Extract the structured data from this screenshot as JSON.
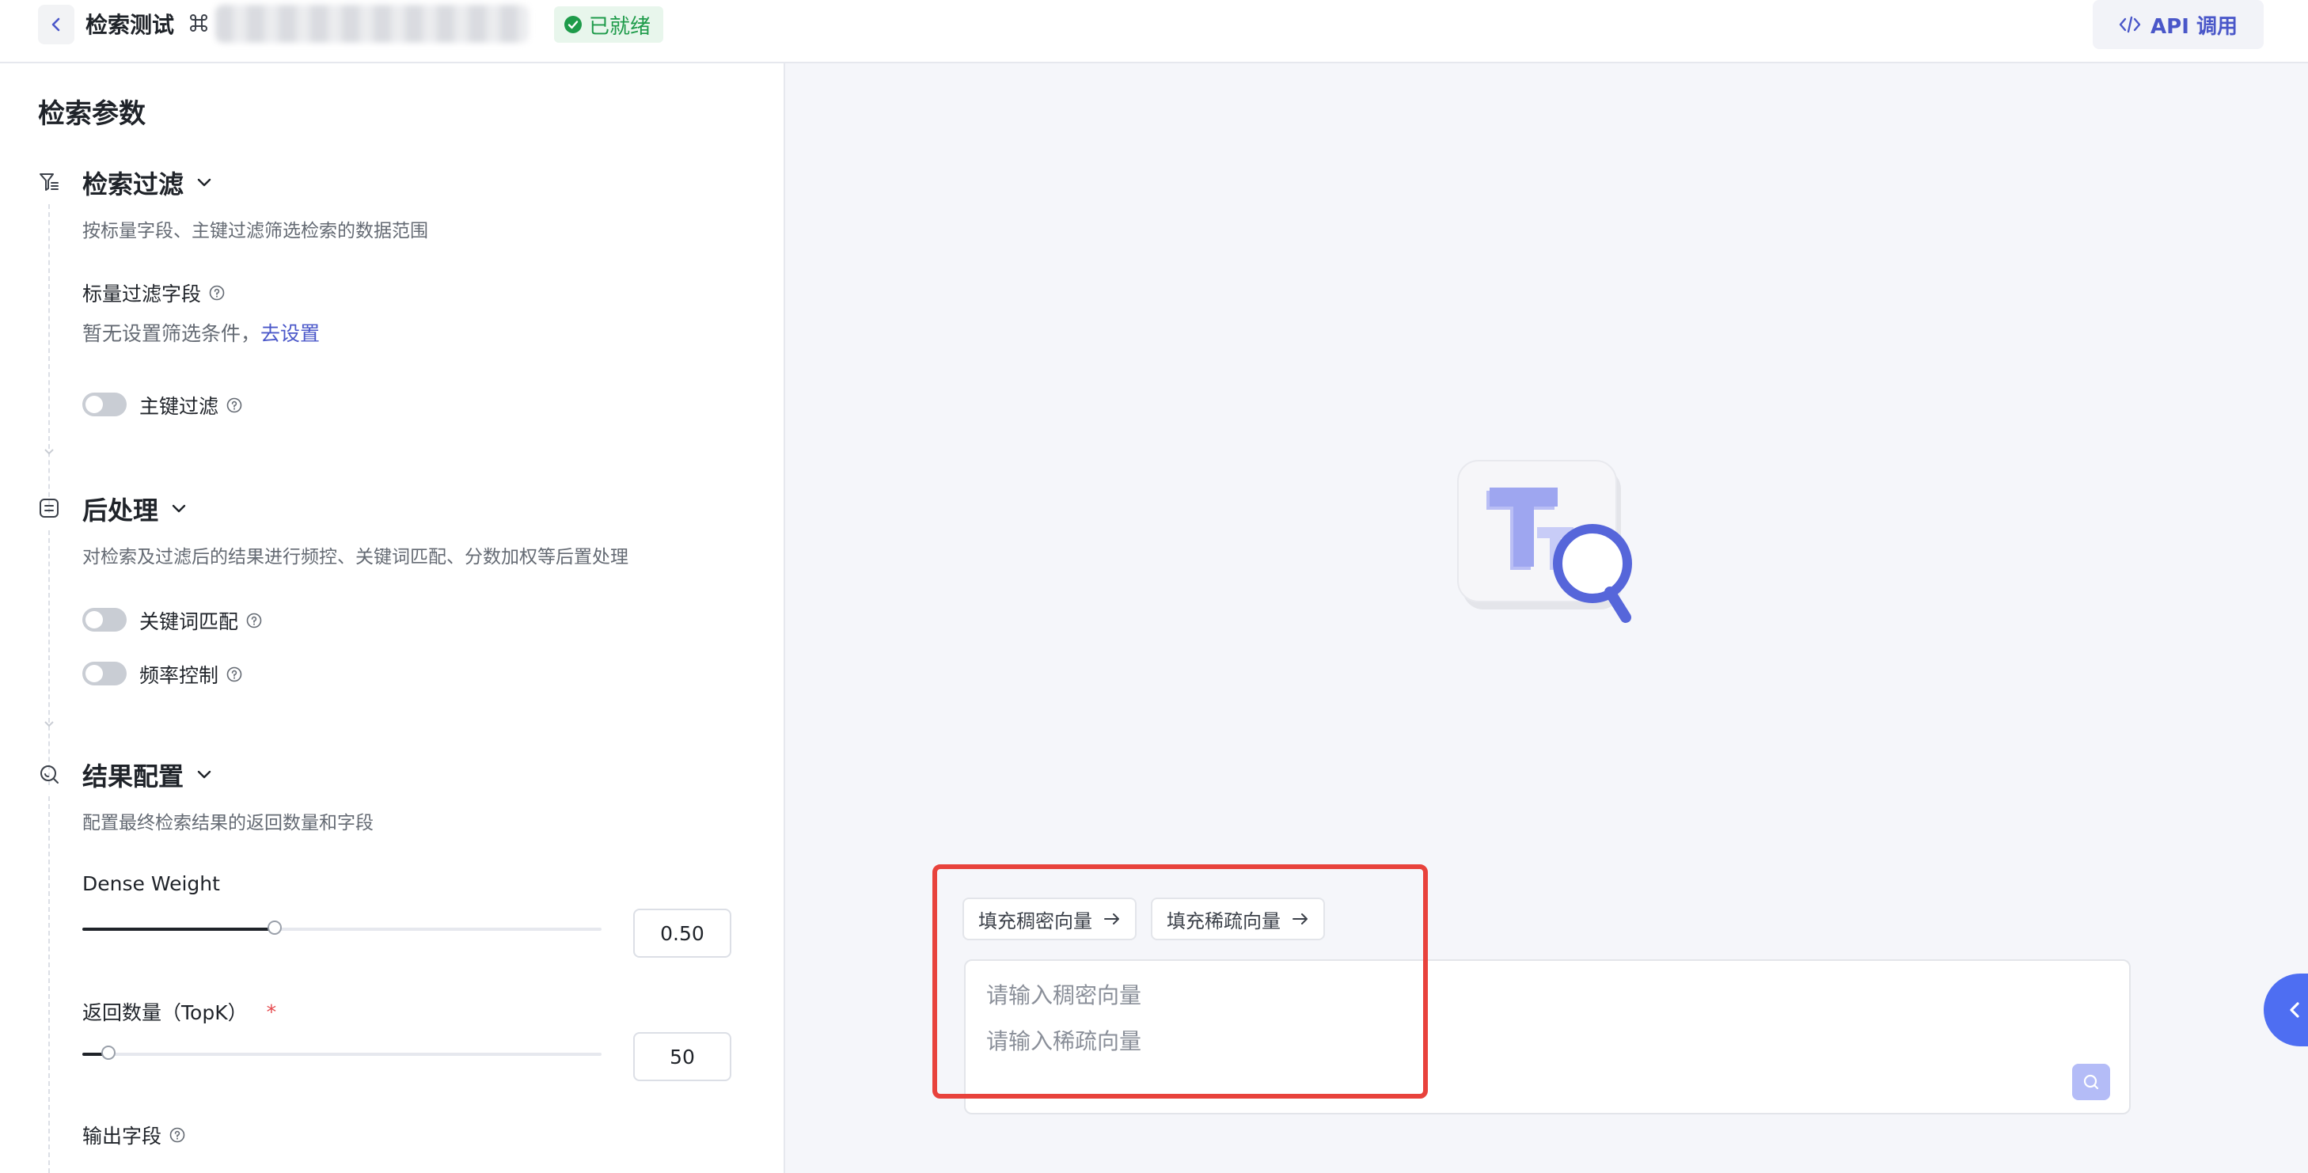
{
  "header": {
    "title": "检索测试",
    "status": "已就绪",
    "api_label": "API 调用"
  },
  "left_panel": {
    "title": "检索参数",
    "filter": {
      "title": "检索过滤",
      "desc": "按标量字段、主键过滤筛选检索的数据范围",
      "scalar_label": "标量过滤字段",
      "empty_text": "暂无设置筛选条件，",
      "setup_link": "去设置",
      "pk_toggle": "主键过滤"
    },
    "post": {
      "title": "后处理",
      "desc": "对检索及过滤后的结果进行频控、关键词匹配、分数加权等后置处理",
      "keyword_toggle": "关键词匹配",
      "freq_toggle": "频率控制"
    },
    "result": {
      "title": "结果配置",
      "desc": "配置最终检索结果的返回数量和字段",
      "dense_label": "Dense Weight",
      "dense_value": "0.50",
      "dense_ratio": 0.37,
      "topk_label": "返回数量（TopK）",
      "topk_required": "*",
      "topk_value": "50",
      "topk_ratio": 0.05,
      "output_label": "输出字段"
    }
  },
  "main": {
    "chip_dense": "填充稠密向量",
    "chip_sparse": "填充稀疏向量",
    "dense_placeholder": "请输入稠密向量",
    "sparse_placeholder": "请输入稀疏向量"
  },
  "colors": {
    "accent": "#4a57c9",
    "ready_green": "#1e9b4a",
    "highlight_red": "#e8423c",
    "side_toggle": "#4e6ef2"
  }
}
